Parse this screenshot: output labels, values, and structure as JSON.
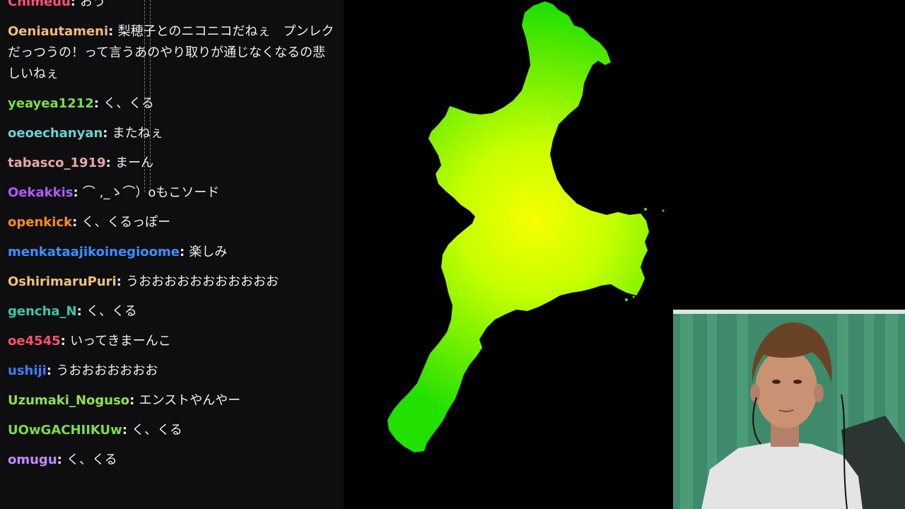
{
  "chat": {
    "messages": [
      {
        "user": "Chimeuu",
        "sep": ": ",
        "text": "おう",
        "color": "#ff4f7a"
      },
      {
        "user": "Oeniautameni",
        "sep": ": ",
        "text": "梨穂子とのニコニコだねぇ　プンレクだっつうの！って言うあのやり取りが通じなくなるの悲しいねぇ",
        "color": "#f5b97a"
      },
      {
        "user": "yeayea1212",
        "sep": ": ",
        "text": "く、くる",
        "color": "#7cdc4a"
      },
      {
        "user": "oeoechanyan",
        "sep": ": ",
        "text": "またねぇ",
        "color": "#6ad1d1"
      },
      {
        "user": "tabasco_1919",
        "sep": ": ",
        "text": "まーん",
        "color": "#e8a6a6"
      },
      {
        "user": "Oekakkis",
        "sep": ": ",
        "text": "⌒ ,_ゝ⌒）oもこソード",
        "color": "#b05cff"
      },
      {
        "user": "openkick",
        "sep": ": ",
        "text": "く、くるっぽー",
        "color": "#ff8c1a"
      },
      {
        "user": "menkataajikoinegioome",
        "sep": ": ",
        "text": "楽しみ",
        "color": "#3d8fff"
      },
      {
        "user": "OshirimaruPuri",
        "sep": ": ",
        "text": "うおおおおおおおおおおお",
        "color": "#f0c27a"
      },
      {
        "user": "gencha_N",
        "sep": ": ",
        "text": "く、くる",
        "color": "#3cc7a6"
      },
      {
        "user": "oe4545",
        "sep": ": ",
        "text": "いってきまーんこ",
        "color": "#ff4f6e"
      },
      {
        "user": "ushiji",
        "sep": ": ",
        "text": "うおおおおおおお",
        "color": "#3d7dff"
      },
      {
        "user": "Uzumaki_Noguso",
        "sep": ": ",
        "text": "エンストやんやー",
        "color": "#8ee04a"
      },
      {
        "user": "UOwGACHIIKUw",
        "sep": ": ",
        "text": "く、くる",
        "color": "#7cdc4a"
      },
      {
        "user": "omugu",
        "sep": ": ",
        "text": "く、くる",
        "color": "#c08cff"
      }
    ]
  },
  "map": {
    "region": "Mie Prefecture",
    "colors": {
      "center": "#f6ff00",
      "mid": "#c8ff00",
      "edge": "#22e000",
      "background": "#000000"
    }
  },
  "webcam": {
    "colors": {
      "wall": "#3f8a6a",
      "curtain": "#4a9a78",
      "shirt": "#e4e4e4",
      "skin": "#c99272",
      "hair": "#6a4326"
    }
  }
}
